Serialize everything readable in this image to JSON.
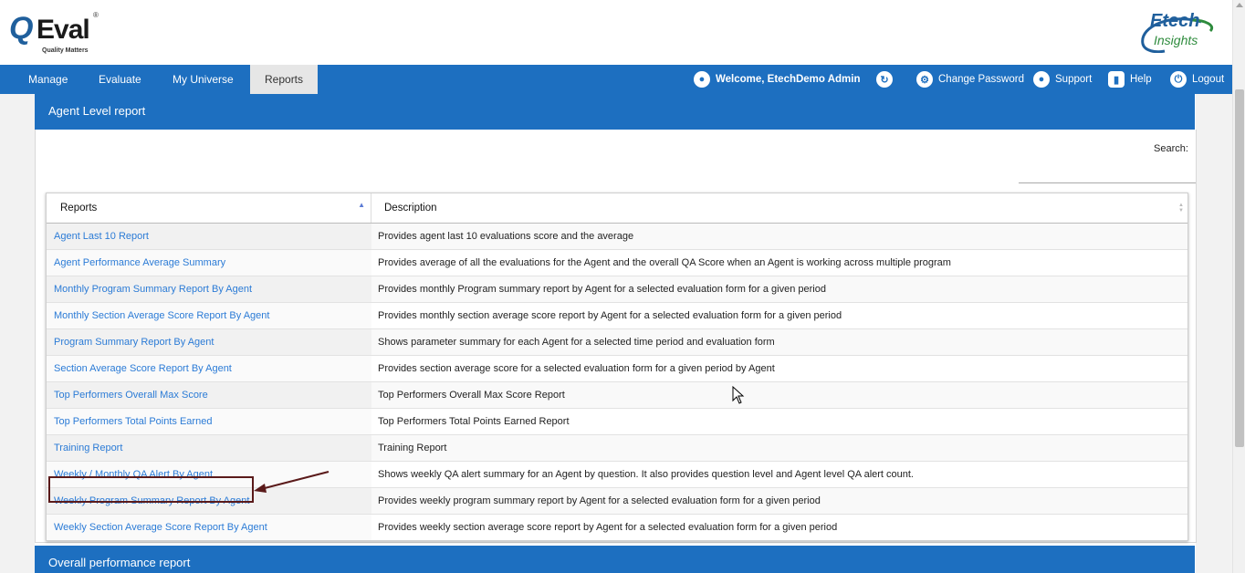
{
  "logo_left": {
    "q": "Q",
    "brand": "Eval",
    "tagline": "Quality Matters",
    "reg": "®"
  },
  "logo_right": {
    "line1": "Etech",
    "line2": "Insights"
  },
  "nav": [
    {
      "label": "Manage"
    },
    {
      "label": "Evaluate"
    },
    {
      "label": "My Universe"
    },
    {
      "label": "Reports",
      "active": true
    }
  ],
  "user_menu": {
    "welcome": "Welcome, EtechDemo Admin",
    "change_password": "Change Password",
    "support": "Support",
    "help": "Help",
    "logout": "Logout"
  },
  "panel": {
    "title": "Agent Level report"
  },
  "search": {
    "label": "Search:",
    "value": ""
  },
  "table": {
    "headers": [
      "Reports",
      "Description"
    ],
    "rows": [
      {
        "report": "Agent Last 10 Report",
        "description": "Provides agent last 10 evaluations score and the average"
      },
      {
        "report": "Agent Performance Average Summary",
        "description": "Provides average of all the evaluations for the Agent and the overall QA Score when an Agent is working across multiple program"
      },
      {
        "report": "Monthly Program Summary Report By Agent",
        "description": "Provides monthly Program summary report by Agent for a selected evaluation form for a given period"
      },
      {
        "report": "Monthly Section Average Score Report By Agent",
        "description": "Provides monthly section average score report by Agent for a selected evaluation form for a given period"
      },
      {
        "report": "Program Summary Report By Agent",
        "description": "Shows parameter summary for each Agent for a selected time period and evaluation form"
      },
      {
        "report": "Section Average Score Report By Agent",
        "description": "Provides section average score for a selected evaluation form for a given period by Agent"
      },
      {
        "report": "Top Performers Overall Max Score",
        "description": "Top Performers Overall Max Score Report"
      },
      {
        "report": "Top Performers Total Points Earned",
        "description": "Top Performers Total Points Earned Report"
      },
      {
        "report": "Training Report",
        "description": "Training Report"
      },
      {
        "report": "Weekly / Monthly QA Alert By Agent",
        "description": "Shows weekly QA alert summary for an Agent by question. It also provides question level and Agent level QA alert count."
      },
      {
        "report": "Weekly Program Summary Report By Agent",
        "description": "Provides weekly program summary report by Agent for a selected evaluation form for a given period"
      },
      {
        "report": "Weekly Section Average Score Report By Agent",
        "description": "Provides weekly section average score report by Agent for a selected evaluation form for a given period"
      }
    ]
  },
  "panel2": {
    "title": "Overall performance report"
  },
  "colors": {
    "nav_bg": "#1d6fc0",
    "link": "#2b7bd6",
    "highlight": "#5a1a1a"
  }
}
